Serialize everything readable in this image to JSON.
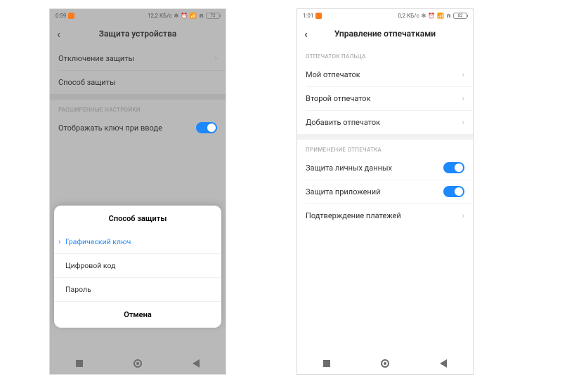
{
  "phone1": {
    "status": {
      "time": "0:59",
      "right": "12,2 КБ/с",
      "battery": "72"
    },
    "title": "Защита устройства",
    "rows": {
      "disable": "Отключение защиты",
      "method": "Способ защиты"
    },
    "section_adv": "РАСШИРЕННЫЕ НАСТРОЙКИ",
    "show_key": "Отображать ключ при вводе",
    "sheet": {
      "title": "Способ защиты",
      "opt_pattern": "Графический ключ",
      "opt_pin": "Цифровой код",
      "opt_password": "Пароль",
      "cancel": "Отмена"
    }
  },
  "phone2": {
    "status": {
      "time": "1:01",
      "right": "0,2 КБ/с",
      "battery": "82"
    },
    "title": "Управление отпечатками",
    "section_finger": "ОТПЕЧАТОК ПАЛЬЦА",
    "rows": {
      "my": "Мой отпечаток",
      "second": "Второй отпечаток",
      "add": "Добавить отпечаток"
    },
    "section_usage": "ПРИМЕНЕНИЕ ОТПЕЧАТКА",
    "rows2": {
      "privacy": "Защита личных данных",
      "apps": "Защита приложений",
      "pay": "Подтверждение платежей"
    }
  }
}
